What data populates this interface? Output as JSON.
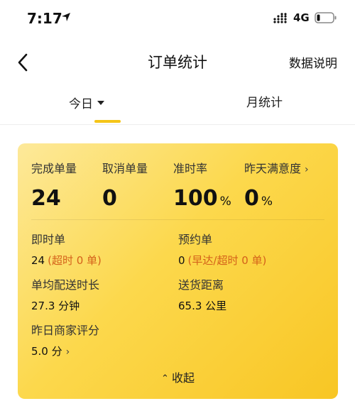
{
  "status_bar": {
    "time": "7:17",
    "network": "4G"
  },
  "nav": {
    "title": "订单统计",
    "action": "数据说明"
  },
  "tabs": [
    {
      "label": "今日",
      "active": true
    },
    {
      "label": "月统计",
      "active": false
    }
  ],
  "card": {
    "metrics": [
      {
        "label": "完成单量",
        "value": "24",
        "unit": ""
      },
      {
        "label": "取消单量",
        "value": "0",
        "unit": ""
      },
      {
        "label": "准时率",
        "value": "100",
        "unit": "%"
      },
      {
        "label": "昨天满意度",
        "value": "0",
        "unit": "%"
      }
    ],
    "instant": {
      "label": "即时单",
      "value": "24",
      "note": "(超时 0 单)"
    },
    "reserved": {
      "label": "预约单",
      "value": "0",
      "note": "(早达/超时 0 单)"
    },
    "avg_time": {
      "label": "单均配送时长",
      "value": "27.3 分钟"
    },
    "distance": {
      "label": "送货距离",
      "value": "65.3 公里"
    },
    "merchant_rating": {
      "label": "昨日商家评分",
      "value": "5.0 分"
    },
    "collapse_label": "收起"
  },
  "colors": {
    "accent": "#f5c518",
    "note": "#d4611a",
    "card_gradient_start": "#fde99a",
    "card_gradient_end": "#f8c624"
  }
}
